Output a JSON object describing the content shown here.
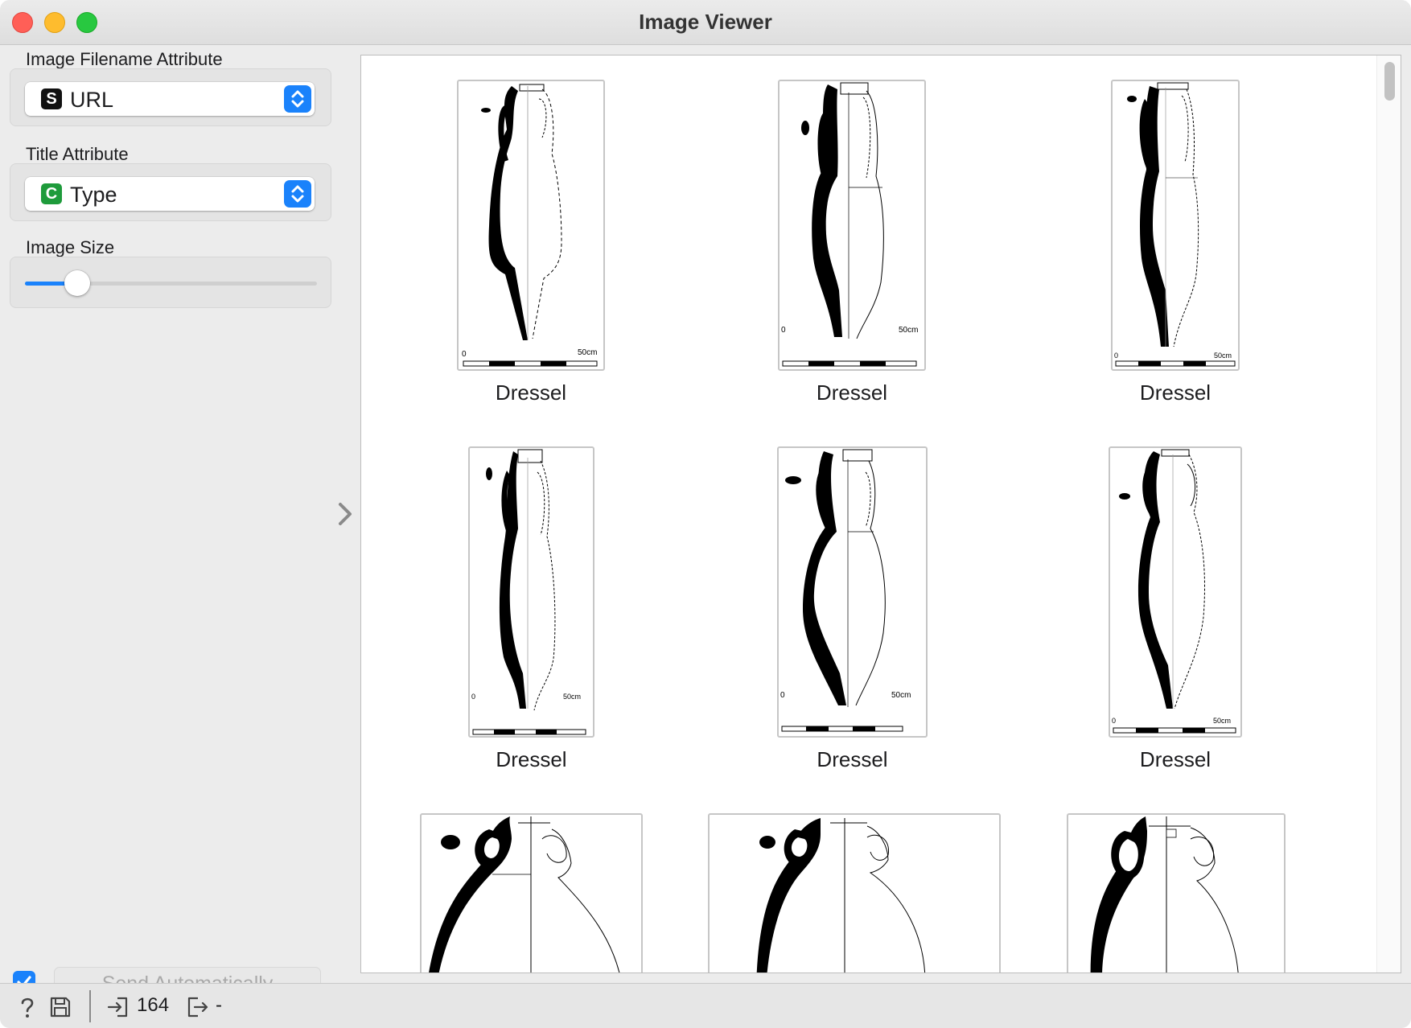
{
  "window": {
    "title": "Image Viewer"
  },
  "sidebar": {
    "filename_attr": {
      "label": "Image Filename Attribute",
      "type_badge": "S",
      "value": "URL"
    },
    "title_attr": {
      "label": "Title Attribute",
      "type_badge": "C",
      "value": "Type"
    },
    "image_size": {
      "label": "Image Size",
      "value_fraction": 0.18
    },
    "send_automatically": {
      "checked": true,
      "label": "Send Automatically"
    }
  },
  "gallery": {
    "items": [
      {
        "title": "Dressel",
        "scale_start": "0",
        "scale_end": "50cm"
      },
      {
        "title": "Dressel",
        "scale_start": "0",
        "scale_end": "50cm"
      },
      {
        "title": "Dressel",
        "scale_start": "0",
        "scale_end": "50cm"
      },
      {
        "title": "Dressel",
        "scale_start": "0",
        "scale_end": "50cm"
      },
      {
        "title": "Dressel",
        "scale_start": "0",
        "scale_end": "50cm"
      },
      {
        "title": "Dressel",
        "scale_start": "0",
        "scale_end": "50cm"
      }
    ]
  },
  "statusbar": {
    "input_count": "164",
    "output_count": "-"
  },
  "colors": {
    "accent": "#1a82fb",
    "badge_string": "#111111",
    "badge_categorical": "#1e9b3b"
  }
}
